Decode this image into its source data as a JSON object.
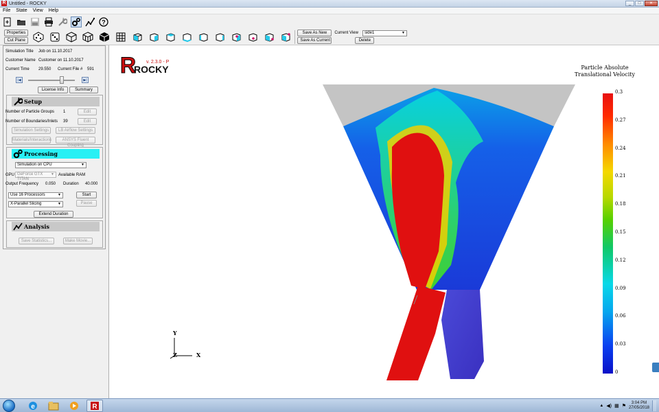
{
  "window": {
    "title": "Untitled - ROCKY"
  },
  "menu": [
    "File",
    "State",
    "View",
    "Help"
  ],
  "toolbar2": {
    "properties": "Properties",
    "cut_plane": "Cut Plane",
    "save_as_new": "Save As New",
    "save_as_current": "Save As Current",
    "current_view_label": "Current View",
    "current_view_value": "side1",
    "delete": "Delete"
  },
  "info": {
    "simulation_title_label": "Simulation Title",
    "simulation_title": "Job on 11.10.2017",
    "customer_name_label": "Customer Name",
    "customer_name": "Customer on 11.10.2017",
    "current_time_label": "Current Time",
    "current_time": "29.550",
    "current_file_label": "Current File #",
    "current_file": "591",
    "license_info": "License Info",
    "summary": "Summary"
  },
  "setup": {
    "title": "Setup",
    "particle_groups_label": "Number of Particle Groups",
    "particle_groups": "1",
    "boundaries_label": "Number of Boundaries/Inlets",
    "boundaries": "39",
    "edit": "Edit",
    "simulation_settings": "Simulation Settings",
    "lb_airflow": "LB Airflow Settings",
    "materials": "Materials/Interactions",
    "ansys": "ANSYS Fluent Coupling"
  },
  "processing": {
    "title": "Processing",
    "mode": "Simulation on CPU",
    "gpu_label": "GPU",
    "gpu_value": "GeForce GTX TITAN",
    "available_ram": "Available RAM",
    "output_freq_label": "Output Frequency",
    "output_freq": "0.050",
    "duration_label": "Duration",
    "duration": "40.000",
    "processors": "Use 16 Processors",
    "slicing": "X-Parallel Slicing",
    "start": "Start",
    "pause": "Pause",
    "extend_duration": "Extend Duration"
  },
  "analysis": {
    "title": "Analysis",
    "save_statistics": "Save Statistics...",
    "make_movie": "Make Movie..."
  },
  "viewport": {
    "logo_text": "ROCKY",
    "logo_version": "v. 2.3.0 - P",
    "colorbar_title_line1": "Particle Absolute",
    "colorbar_title_line2": "Translational Velocity",
    "colorbar_ticks": [
      "0.3",
      "0.27",
      "0.24",
      "0.21",
      "0.18",
      "0.15",
      "0.12",
      "0.09",
      "0.06",
      "0.03",
      "0"
    ],
    "axis_y": "Y",
    "axis_z": "Z",
    "axis_x": "X"
  },
  "taskbar": {
    "time": "3:04 PM",
    "date": "27/05/2018"
  },
  "colors": {
    "accent_cyan": "#28f0f4",
    "particle_red": "#e01010",
    "particle_blue": "#1a3ad8",
    "hopper_gray": "#c4c4c4"
  }
}
